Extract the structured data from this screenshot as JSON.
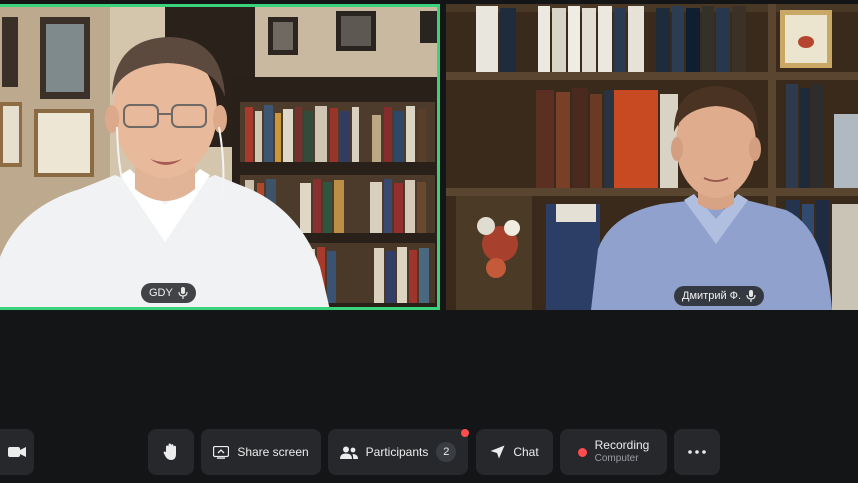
{
  "participants": [
    {
      "name": "GDY",
      "speaking": true,
      "mic_icon": "mic-icon"
    },
    {
      "name": "Дмитрий Ф.",
      "speaking": false,
      "mic_icon": "mic-icon"
    }
  ],
  "toolbar": {
    "camera_icon": "camera-icon",
    "raise_hand_icon": "hand-icon",
    "share_screen": {
      "label": "Share screen",
      "icon": "share-screen-icon"
    },
    "participants": {
      "label": "Participants",
      "count": "2",
      "icon": "people-icon",
      "has_notification": true
    },
    "chat": {
      "label": "Chat",
      "icon": "send-icon"
    },
    "recording": {
      "label": "Recording",
      "sublabel": "Computer",
      "icon": "record-dot-icon"
    },
    "more_icon": "more-icon"
  },
  "colors": {
    "active_speaker_border": "#3ad27a",
    "background": "#141517",
    "button": "#26282c",
    "record_red": "#ff4d4f"
  }
}
